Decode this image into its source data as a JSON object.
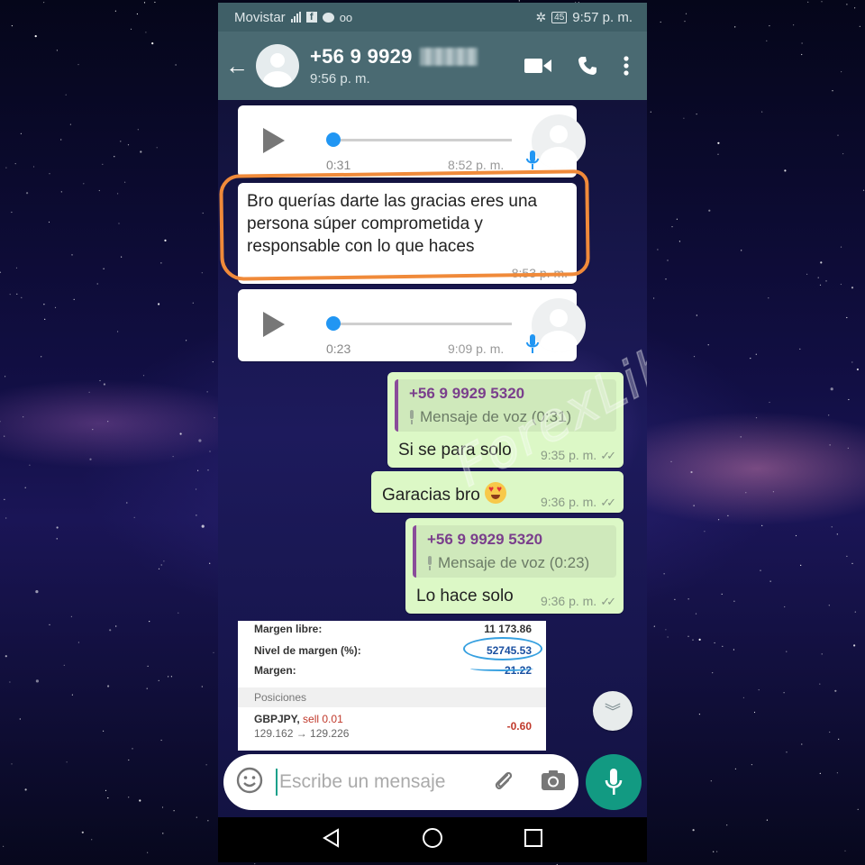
{
  "statusbar": {
    "carrier": "Movistar",
    "battery": "45",
    "time": "9:57 p. m."
  },
  "header": {
    "contact_name": "+56 9 9929",
    "last_seen": "9:56 p. m."
  },
  "messages": {
    "voice1": {
      "duration": "0:31",
      "time": "8:52 p. m."
    },
    "text1": {
      "text": "Bro querías darte las gracias eres una persona súper comprometida y responsable con lo que haces",
      "time": "8:53 p. m."
    },
    "voice2": {
      "duration": "0:23",
      "time": "9:09 p. m."
    },
    "reply1": {
      "quote_name": "+56 9 9929 5320",
      "quote_text": "Mensaje de voz (0:31)",
      "text": "Si se para solo",
      "time": "9:35 p. m."
    },
    "thanks": {
      "text": "Garacias bro",
      "time": "9:36 p. m."
    },
    "reply2": {
      "quote_name": "+56 9 9929 5320",
      "quote_text": "Mensaje de voz (0:23)",
      "text": "Lo hace solo",
      "time": "9:36 p. m."
    }
  },
  "screenshot": {
    "free_margin_label": "Margen libre:",
    "free_margin_value": "11 173.86",
    "margin_level_label": "Nivel de margen (%):",
    "margin_level_value": "52745.53",
    "margin_label": "Margen:",
    "margin_value": "21.22",
    "positions_header": "Posiciones",
    "position_symbol": "GBPJPY,",
    "position_side": "sell 0.01",
    "position_prices": "129.162 → 129.226",
    "position_pl": "-0.60"
  },
  "input": {
    "placeholder": "Escribe un mensaje"
  },
  "watermark": "ForexLiberty",
  "colors": {
    "header_bg": "#4a6a72",
    "outgoing_bubble": "#dcf8c6",
    "incoming_bubble": "#ffffff",
    "highlight": "#f08a3a",
    "mic_button": "#129a82",
    "voice_progress": "#2196f3"
  }
}
